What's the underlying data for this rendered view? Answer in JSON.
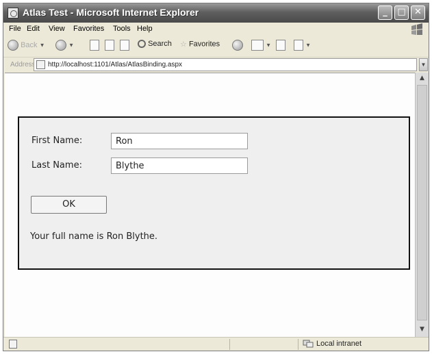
{
  "window": {
    "title": "Atlas Test - Microsoft Internet Explorer"
  },
  "menu": {
    "items": [
      "File",
      "Edit",
      "View",
      "Favorites",
      "Tools",
      "Help"
    ]
  },
  "toolbar": {
    "back_label": "Back",
    "search_label": "Search",
    "favorites_label": "Favorites"
  },
  "address": {
    "label": "Address",
    "url": "http://localhost:1101/Atlas/AtlasBinding.aspx"
  },
  "form": {
    "first_name_label": "First Name:",
    "first_name_value": "Ron",
    "last_name_label": "Last Name:",
    "last_name_value": "Blythe",
    "ok_label": "OK",
    "result_text": "Your full name is Ron Blythe."
  },
  "status": {
    "zone": "Local intranet"
  },
  "icons": {
    "app": "ie-page-icon",
    "minimize": "minimize-icon",
    "maximize": "maximize-icon",
    "close": "close-icon",
    "back": "back-arrow-icon",
    "forward": "forward-arrow-icon",
    "stop": "stop-icon",
    "refresh": "refresh-icon",
    "home": "home-icon",
    "search": "search-icon",
    "favorites": "star-icon",
    "media": "media-icon",
    "mail": "mail-icon",
    "print": "print-icon",
    "edit": "edit-icon",
    "windows_flag": "windows-flag-icon"
  }
}
